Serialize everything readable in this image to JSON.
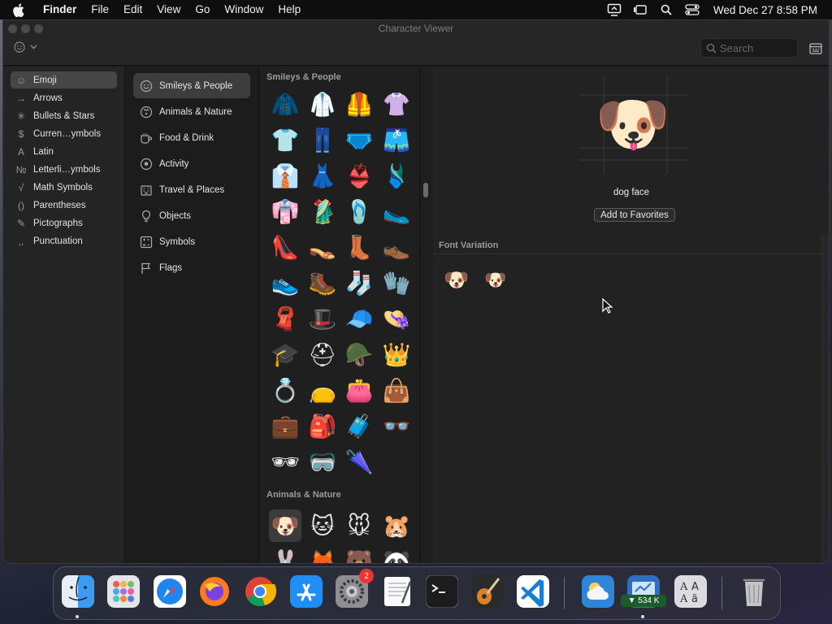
{
  "menubar": {
    "app_name": "Finder",
    "menus": [
      "File",
      "Edit",
      "View",
      "Go",
      "Window",
      "Help"
    ],
    "clock": "Wed Dec 27  8:58 PM",
    "status_icons": [
      "screen-mirroring-icon",
      "stage-manager-icon",
      "spotlight-icon",
      "control-center-icon"
    ]
  },
  "window": {
    "title": "Character Viewer",
    "search_placeholder": "Search"
  },
  "sidebar": {
    "items": [
      {
        "label": "Emoji",
        "icon": "☺"
      },
      {
        "label": "Arrows",
        "icon": "→"
      },
      {
        "label": "Bullets & Stars",
        "icon": "✳"
      },
      {
        "label": "Curren…ymbols",
        "icon": "$"
      },
      {
        "label": "Latin",
        "icon": "A"
      },
      {
        "label": "Letterli…ymbols",
        "icon": "№"
      },
      {
        "label": "Math Symbols",
        "icon": "√"
      },
      {
        "label": "Parentheses",
        "icon": "()"
      },
      {
        "label": "Pictographs",
        "icon": "✎"
      },
      {
        "label": "Punctuation",
        "icon": ",,"
      }
    ],
    "selected": 0
  },
  "categories": {
    "items": [
      {
        "label": "Smileys & People",
        "icon": "smiley-icon"
      },
      {
        "label": "Animals & Nature",
        "icon": "paw-icon"
      },
      {
        "label": "Food & Drink",
        "icon": "cup-icon"
      },
      {
        "label": "Activity",
        "icon": "ball-icon"
      },
      {
        "label": "Travel & Places",
        "icon": "building-icon"
      },
      {
        "label": "Objects",
        "icon": "lightbulb-icon"
      },
      {
        "label": "Symbols",
        "icon": "symbols-icon"
      },
      {
        "label": "Flags",
        "icon": "flag-icon"
      }
    ],
    "selected": 0
  },
  "grid": {
    "sections": [
      {
        "title": "Smileys & People",
        "emojis": [
          "🧥",
          "🥼",
          "🦺",
          "👚",
          "👕",
          "👖",
          "🩲",
          "🩳",
          "👔",
          "👗",
          "👙",
          "🩱",
          "👘",
          "🥻",
          "🩴",
          "🥿",
          "👠",
          "👡",
          "👢",
          "👞",
          "👟",
          "🥾",
          "🧦",
          "🧤",
          "🧣",
          "🎩",
          "🧢",
          "👒",
          "🎓",
          "⛑",
          "🪖",
          "👑",
          "💍",
          "👝",
          "👛",
          "👜",
          "💼",
          "🎒",
          "🧳",
          "👓",
          "🕶",
          "🥽",
          "🌂"
        ]
      },
      {
        "title": "Animals & Nature",
        "emojis": [
          "🐶",
          "🐱",
          "🐭",
          "🐹",
          "🐰",
          "🦊",
          "🐻",
          "🐼"
        ]
      }
    ],
    "selected_emoji": "🐶"
  },
  "detail": {
    "glyph": "🐶",
    "name": "dog face",
    "favorites_button": "Add to Favorites",
    "font_variation_title": "Font Variation",
    "variations": [
      "🐶",
      "🐶"
    ]
  },
  "dock": {
    "apps": [
      {
        "name": "finder-icon",
        "color": "#2b8cf0",
        "running": true
      },
      {
        "name": "launchpad-icon",
        "color": "#d9d9df",
        "running": false
      },
      {
        "name": "safari-icon",
        "color": "#2a8af2",
        "running": false
      },
      {
        "name": "firefox-icon",
        "color": "#ff7a1a",
        "running": false
      },
      {
        "name": "chrome-icon",
        "color": "#ffffff",
        "running": false
      },
      {
        "name": "app-store-icon",
        "color": "#1f8ef7",
        "running": false
      },
      {
        "name": "system-settings-icon",
        "color": "#8a8a8f",
        "running": false,
        "badge": "2"
      },
      {
        "name": "textedit-icon",
        "color": "#f4f4f4",
        "running": false
      },
      {
        "name": "terminal-icon",
        "color": "#1a1a1a",
        "running": false
      },
      {
        "name": "garageband-icon",
        "color": "#2a2a2a",
        "running": false
      },
      {
        "name": "vscode-icon",
        "color": "#ffffff",
        "running": false
      },
      {
        "name": "weather-icon",
        "color": "#2f86d8",
        "running": false
      },
      {
        "name": "screen-monitor-icon",
        "color": "#3a8be0",
        "running": true,
        "label": "▼ 534 K"
      },
      {
        "name": "font-book-icon",
        "color": "#d8d8dc",
        "running": false
      },
      {
        "name": "trash-icon",
        "color": "#b0b0b4",
        "running": false
      }
    ]
  }
}
